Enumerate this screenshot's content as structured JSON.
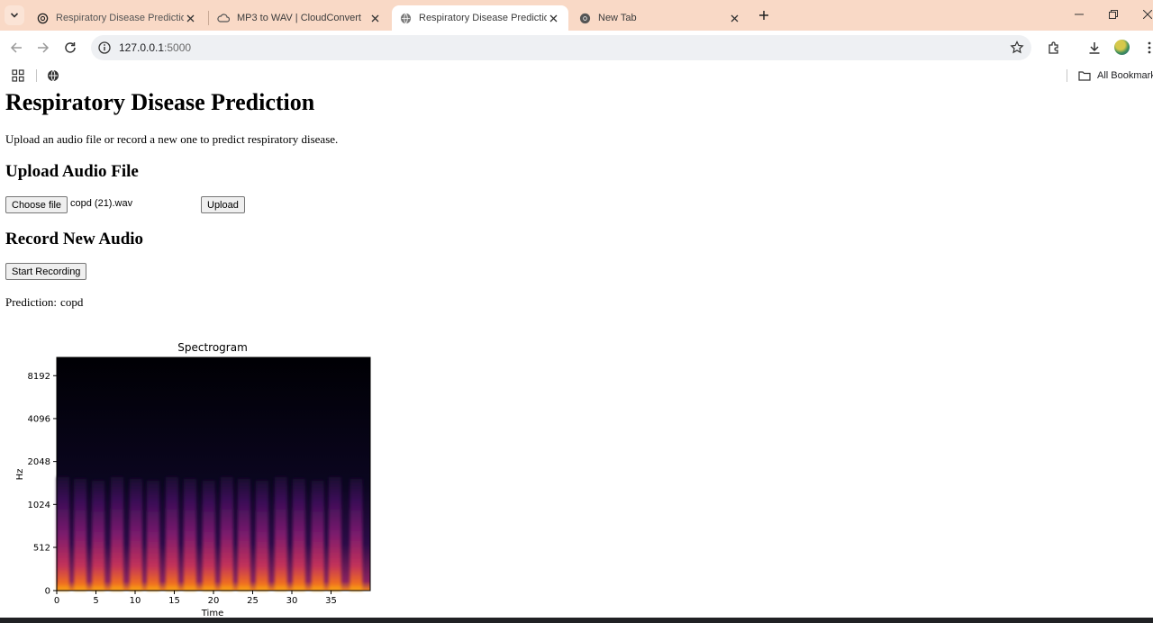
{
  "browser": {
    "tabs": [
      {
        "title": "Respiratory Disease Prediction I",
        "icon": "openai-icon",
        "active": false
      },
      {
        "title": "MP3 to WAV | CloudConvert",
        "icon": "cloud-icon",
        "active": false
      },
      {
        "title": "Respiratory Disease Prediction",
        "icon": "globe-icon",
        "active": true
      },
      {
        "title": "New Tab",
        "icon": "chrome-icon",
        "active": false
      }
    ],
    "url_host": "127.0.0.1",
    "url_port": ":5000",
    "bookmarks_all": "All Bookmarks"
  },
  "page": {
    "title": "Respiratory Disease Prediction",
    "intro": "Upload an audio file or record a new one to predict respiratory disease.",
    "upload_heading": "Upload Audio File",
    "choose_file_label": "Choose file",
    "file_name": "copd (21).wav",
    "upload_label": "Upload",
    "record_heading": "Record New Audio",
    "start_recording_label": "Start Recording",
    "prediction_label": "Prediction:",
    "prediction_value": "copd"
  },
  "chart_data": {
    "type": "heatmap",
    "title": "Spectrogram",
    "xlabel": "Time",
    "ylabel": "Hz",
    "x_ticks": [
      0,
      5,
      10,
      15,
      20,
      25,
      30,
      35
    ],
    "xlim": [
      0,
      40
    ],
    "y_ticks": [
      0,
      512,
      1024,
      2048,
      4096,
      8192
    ],
    "y_scale": "log",
    "colormap": "inferno",
    "burst_times": [
      0.6,
      3,
      5.3,
      7.7,
      10.1,
      12.3,
      14.7,
      17,
      19.4,
      21.7,
      23.9,
      26.2,
      28.6,
      30.9,
      33.3,
      35.5,
      38.2
    ],
    "burst_max_freq_hz": 1600
  }
}
